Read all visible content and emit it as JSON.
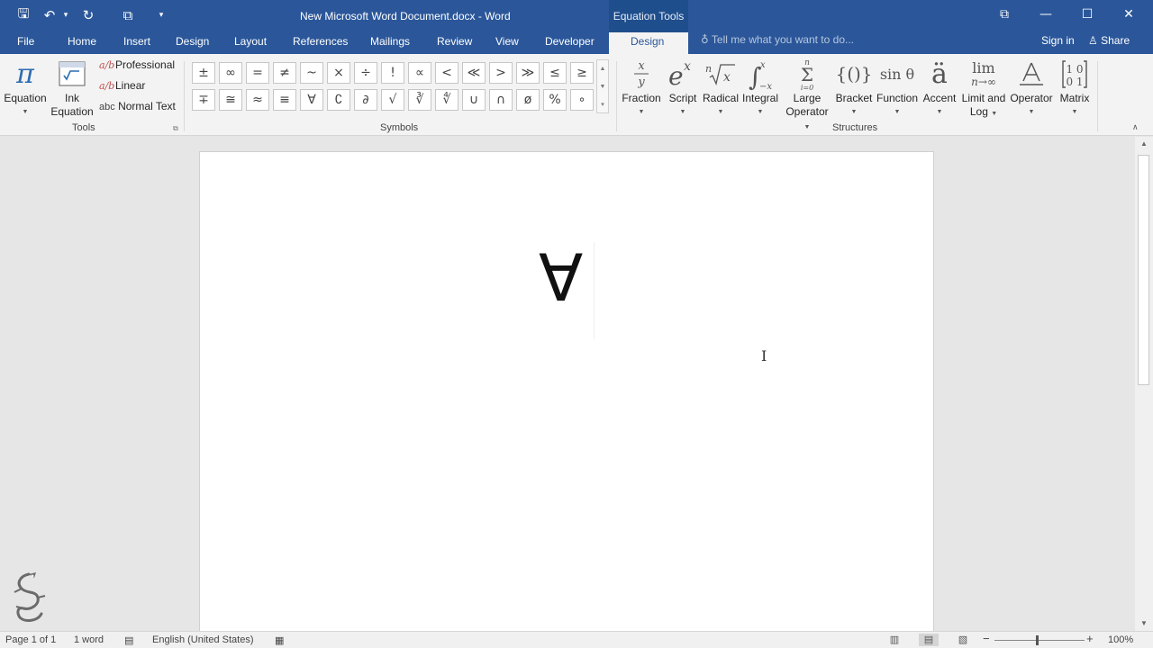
{
  "titlebar": {
    "title": "New Microsoft Word Document.docx - Word",
    "context_group": "Equation Tools",
    "qat": [
      {
        "name": "save-icon",
        "glyph": "🖫"
      },
      {
        "name": "undo-icon",
        "glyph": "↶"
      },
      {
        "name": "undo-dropdown-icon",
        "glyph": "▾"
      },
      {
        "name": "redo-icon",
        "glyph": "↻"
      },
      {
        "name": "touch-mode-icon",
        "glyph": "⧉"
      },
      {
        "name": "customize-qat-icon",
        "glyph": "▾"
      }
    ],
    "window_controls": {
      "ribbon_display": "⧉",
      "minimize": "—",
      "maximize": "☐",
      "close": "✕"
    }
  },
  "tabs": [
    "File",
    "Home",
    "Insert",
    "Design",
    "Layout",
    "References",
    "Mailings",
    "Review",
    "View",
    "Developer",
    "Design"
  ],
  "active_tab_index": 10,
  "tell_me": {
    "icon": "lightbulb-icon",
    "placeholder": "Tell me what you want to do..."
  },
  "account": {
    "sign_in": "Sign in",
    "share": "Share"
  },
  "ribbon": {
    "tools": {
      "label": "Tools",
      "equation": {
        "label": "Equation",
        "glyph": "π"
      },
      "ink_equation": {
        "label1": "Ink",
        "label2": "Equation"
      },
      "professional": "Professional",
      "linear": "Linear",
      "normal_text": "Normal Text",
      "normal_text_icon": "abc"
    },
    "symbols": {
      "label": "Symbols",
      "row1": [
        "±",
        "∞",
        "=",
        "≠",
        "~",
        "×",
        "÷",
        "!",
        "∝",
        "<",
        "≪",
        ">",
        "≫",
        "≤",
        "≥"
      ],
      "row2": [
        "∓",
        "≅",
        "≈",
        "≡",
        "∀",
        "∁",
        "∂",
        "√",
        "∛",
        "∜",
        "∪",
        "∩",
        "ø",
        "%",
        "∘"
      ]
    },
    "structures": {
      "label": "Structures",
      "items": [
        {
          "label": "Fraction",
          "label2": "",
          "icon": "fraction-icon"
        },
        {
          "label": "Script",
          "label2": "",
          "icon": "script-icon"
        },
        {
          "label": "Radical",
          "label2": "",
          "icon": "radical-icon"
        },
        {
          "label": "Integral",
          "label2": "",
          "icon": "integral-icon"
        },
        {
          "label": "Large",
          "label2": "Operator",
          "icon": "large-operator-icon"
        },
        {
          "label": "Bracket",
          "label2": "",
          "icon": "bracket-icon"
        },
        {
          "label": "Function",
          "label2": "",
          "icon": "function-icon"
        },
        {
          "label": "Accent",
          "label2": "",
          "icon": "accent-icon"
        },
        {
          "label": "Limit and",
          "label2": "Log",
          "icon": "limit-log-icon"
        },
        {
          "label": "Operator",
          "label2": "",
          "icon": "operator-icon"
        },
        {
          "label": "Matrix",
          "label2": "",
          "icon": "matrix-icon"
        }
      ]
    }
  },
  "document": {
    "equation_content": "∀"
  },
  "statusbar": {
    "page": "Page 1 of 1",
    "words": "1 word",
    "language": "English (United States)",
    "zoom": "100%",
    "zoom_level": 1.0
  }
}
